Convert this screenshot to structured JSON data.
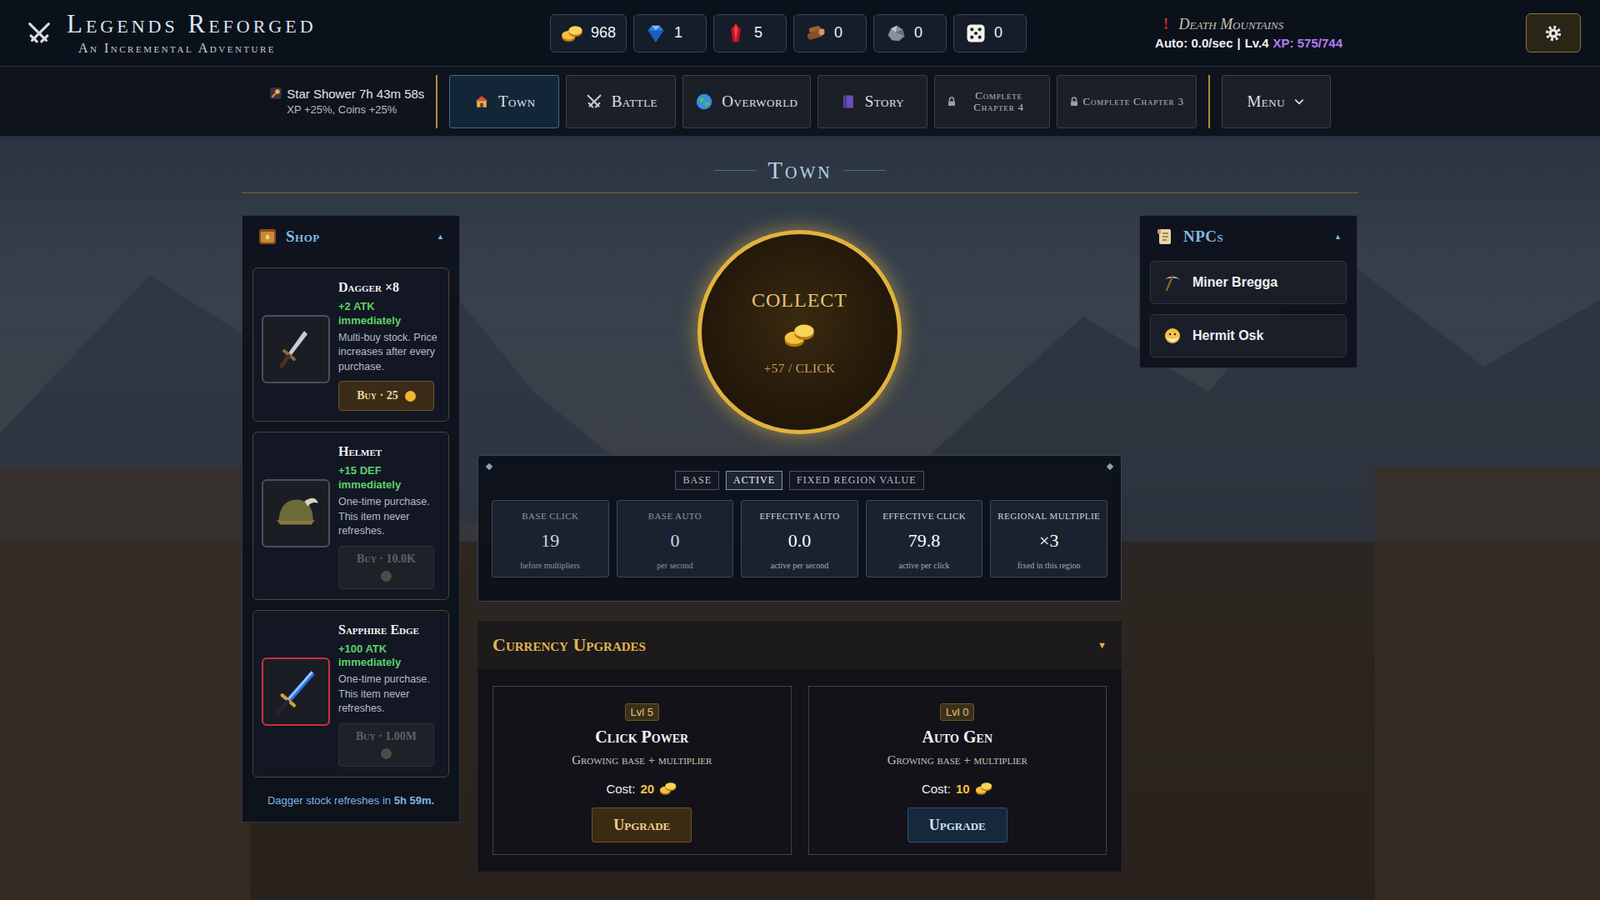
{
  "header": {
    "title": "Legends Reforged",
    "subtitle": "An Incremental Adventure",
    "currencies": [
      {
        "kind": "coins",
        "value": "968"
      },
      {
        "kind": "gems",
        "value": "1"
      },
      {
        "kind": "crystals",
        "value": "5"
      },
      {
        "kind": "wood",
        "value": "0"
      },
      {
        "kind": "ore",
        "value": "0"
      },
      {
        "kind": "dice",
        "value": "0"
      }
    ],
    "region": {
      "alert": "!",
      "name": "Death Mountains"
    },
    "status": {
      "auto": "Auto: 0.0/sec",
      "separator": "|",
      "level": "Lv.4",
      "xp": "XP: 575/744"
    }
  },
  "event": {
    "name": "Star Shower 7h 43m 58s",
    "bonus": "XP +25%, Coins +25%"
  },
  "nav": [
    {
      "kind": "town",
      "label": "Town",
      "selected": true,
      "locked": false
    },
    {
      "kind": "battle",
      "label": "Battle",
      "selected": false,
      "locked": false
    },
    {
      "kind": "overworld",
      "label": "Overworld",
      "selected": false,
      "locked": false
    },
    {
      "kind": "story",
      "label": "Story",
      "selected": false,
      "locked": false
    },
    {
      "kind": "locked",
      "label": "Complete Chapter 4",
      "selected": false,
      "locked": true
    },
    {
      "kind": "locked",
      "label": "Complete Chapter 3",
      "selected": false,
      "locked": true
    }
  ],
  "menu": {
    "label": "Menu",
    "expanded": false
  },
  "page_title": "Town",
  "shop": {
    "title": "Shop",
    "toggle": "▲",
    "expanded": true,
    "items": [
      {
        "kind": "dagger",
        "name": "Dagger ×8",
        "effect": "+2 ATK immediately",
        "description": "Multi-buy stock. Price increases after every purchase.",
        "button": "Buy · 25",
        "disabled": false,
        "color": "#4a4f5a"
      },
      {
        "kind": "helmet",
        "name": "Helmet",
        "effect": "+15 DEF immediately",
        "description": "One-time purchase. This item never refreshes.",
        "button": "Buy · 10.0K",
        "disabled": true,
        "color": "#4a4f5a"
      },
      {
        "kind": "sword",
        "name": "Sapphire Edge",
        "effect": "+100 ATK immediately",
        "description": "One-time purchase. This item never refreshes.",
        "button": "Buy · 1.00M",
        "disabled": true,
        "color": "#c8323c"
      }
    ],
    "footer": {
      "text": "Dagger stock refreshes in",
      "time": "5h 59m."
    }
  },
  "collect": {
    "label": "COLLECT",
    "rate": "+57 / CLICK"
  },
  "stats": {
    "tabs": [
      {
        "label": "BASE",
        "selected": false
      },
      {
        "label": "ACTIVE",
        "selected": true
      },
      {
        "label": "FIXED REGION VALUE",
        "selected": false
      }
    ],
    "cards": [
      {
        "label": "BASE CLICK",
        "value": "19",
        "note": "before multipliers",
        "dimmed": true
      },
      {
        "label": "BASE AUTO",
        "value": "0",
        "note": "per second",
        "dimmed": true
      },
      {
        "label": "EFFECTIVE AUTO",
        "value": "0.0",
        "note": "active per second",
        "dimmed": false
      },
      {
        "label": "EFFECTIVE CLICK",
        "value": "79.8",
        "note": "active per click",
        "dimmed": false
      },
      {
        "label": "REGIONAL MULTIPLIE",
        "value": "×3",
        "note": "fixed in this region",
        "dimmed": false
      }
    ]
  },
  "upgrades": {
    "title": "Currency Upgrades",
    "toggle": "▼",
    "expanded": true,
    "cards": [
      {
        "kind": "click",
        "level": "Lvl 5",
        "name": "Click Power",
        "description": "Growing base + multiplier",
        "cost_label": "Cost:",
        "cost": "20",
        "button": "Upgrade"
      },
      {
        "kind": "auto",
        "level": "Lvl 0",
        "name": "Auto Gen",
        "description": "Growing base + multiplier",
        "cost_label": "Cost:",
        "cost": "10",
        "button": "Upgrade"
      }
    ]
  },
  "npcs": {
    "title": "NPCs",
    "toggle": "▲",
    "expanded": true,
    "items": [
      {
        "kind": "miner",
        "name": "Miner Bregga"
      },
      {
        "kind": "hermit",
        "name": "Hermit Osk"
      }
    ]
  }
}
